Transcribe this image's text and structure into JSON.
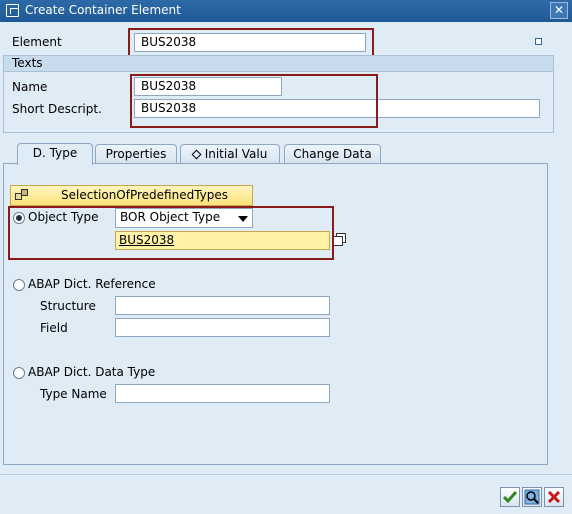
{
  "window": {
    "title": "Create Container Element",
    "close_glyph": "✕"
  },
  "element": {
    "label": "Element",
    "value": "BUS2038"
  },
  "texts": {
    "header": "Texts",
    "name_label": "Name",
    "name_value": "BUS2038",
    "short_label": "Short Descript.",
    "short_value": "BUS2038"
  },
  "tabs": [
    {
      "label": "D. Type",
      "active": true
    },
    {
      "label": "Properties"
    },
    {
      "label": "Initial Valu",
      "icon": "diamond-icon"
    },
    {
      "label": "Change Data"
    }
  ],
  "dtype": {
    "selection_button": "SelectionOfPredefinedTypes",
    "object_type_label": "Object Type",
    "object_type_select": "BOR Object Type",
    "object_type_value": "BUS2038",
    "abap_ref_label": "ABAP Dict. Reference",
    "structure_label": "Structure",
    "structure_value": "",
    "field_label": "Field",
    "field_value": "",
    "abap_type_label": "ABAP Dict. Data Type",
    "type_name_label": "Type Name",
    "type_name_value": ""
  },
  "colors": {
    "background": "#dfebf5",
    "titlebar": "#1f5a96",
    "highlight": "#8b1a1a",
    "input_focus": "#fff3a8",
    "confirm": "#2f8a1e",
    "cancel": "#c21a1a"
  }
}
